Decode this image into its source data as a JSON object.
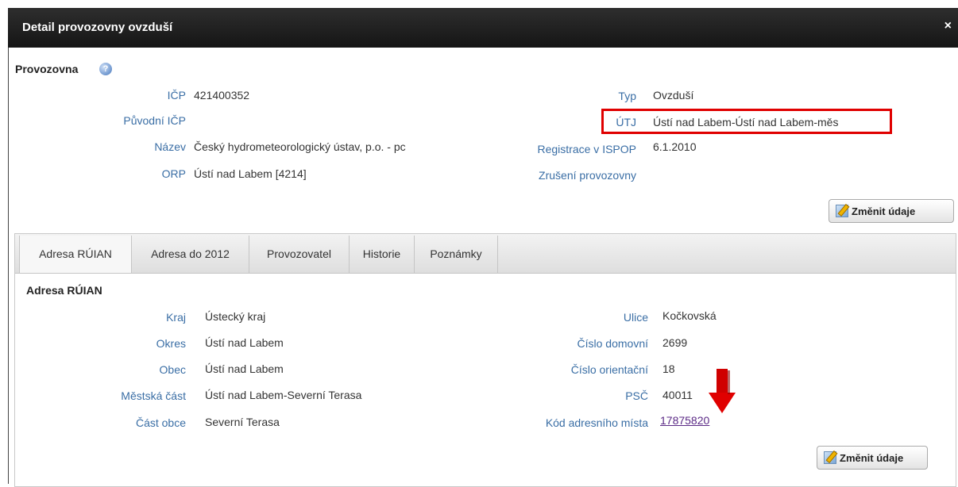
{
  "dialog": {
    "title": "Detail provozovny ovzduší",
    "close_label": "×"
  },
  "provozovna": {
    "section_title": "Provozovna",
    "help_glyph": "?",
    "left": [
      {
        "label": "IČP",
        "value": "421400352"
      },
      {
        "label": "Původní IČP",
        "value": ""
      },
      {
        "label": "Název",
        "value": "Český hydrometeorologický ústav, p.o. - pc"
      },
      {
        "label": "ORP",
        "value": "Ústí nad Labem [4214]"
      }
    ],
    "right": [
      {
        "label": "Typ",
        "value": "Ovzduší"
      },
      {
        "label": "ÚTJ",
        "value": "Ústí nad Labem-Ústí nad Labem-měs"
      },
      {
        "label": "Registrace v ISPOP",
        "value": "6.1.2010"
      },
      {
        "label": "Zrušení provozovny",
        "value": ""
      }
    ],
    "edit_button": "Změnit údaje"
  },
  "tabs": [
    "Adresa RÚIAN",
    "Adresa do 2012",
    "Provozovatel",
    "Historie",
    "Poznámky"
  ],
  "adresa": {
    "section_title": "Adresa RÚIAN",
    "left": [
      {
        "label": "Kraj",
        "value": "Ústecký kraj"
      },
      {
        "label": "Okres",
        "value": "Ústí nad Labem"
      },
      {
        "label": "Obec",
        "value": "Ústí nad Labem"
      },
      {
        "label": "Městská část",
        "value": "Ústí nad Labem-Severní Terasa"
      },
      {
        "label": "Část obce",
        "value": "Severní Terasa"
      }
    ],
    "right": [
      {
        "label": "Ulice",
        "value": "Kočkovská"
      },
      {
        "label": "Číslo domovní",
        "value": "2699"
      },
      {
        "label": "Číslo orientační",
        "value": "18"
      },
      {
        "label": "PSČ",
        "value": "40011"
      },
      {
        "label": "Kód adresního místa",
        "value": "17875820"
      }
    ],
    "edit_button": "Změnit údaje"
  },
  "colors": {
    "label": "#3a6ea5",
    "highlight": "#e00000",
    "arrow": "#e00000",
    "link": "#5b2a86"
  }
}
